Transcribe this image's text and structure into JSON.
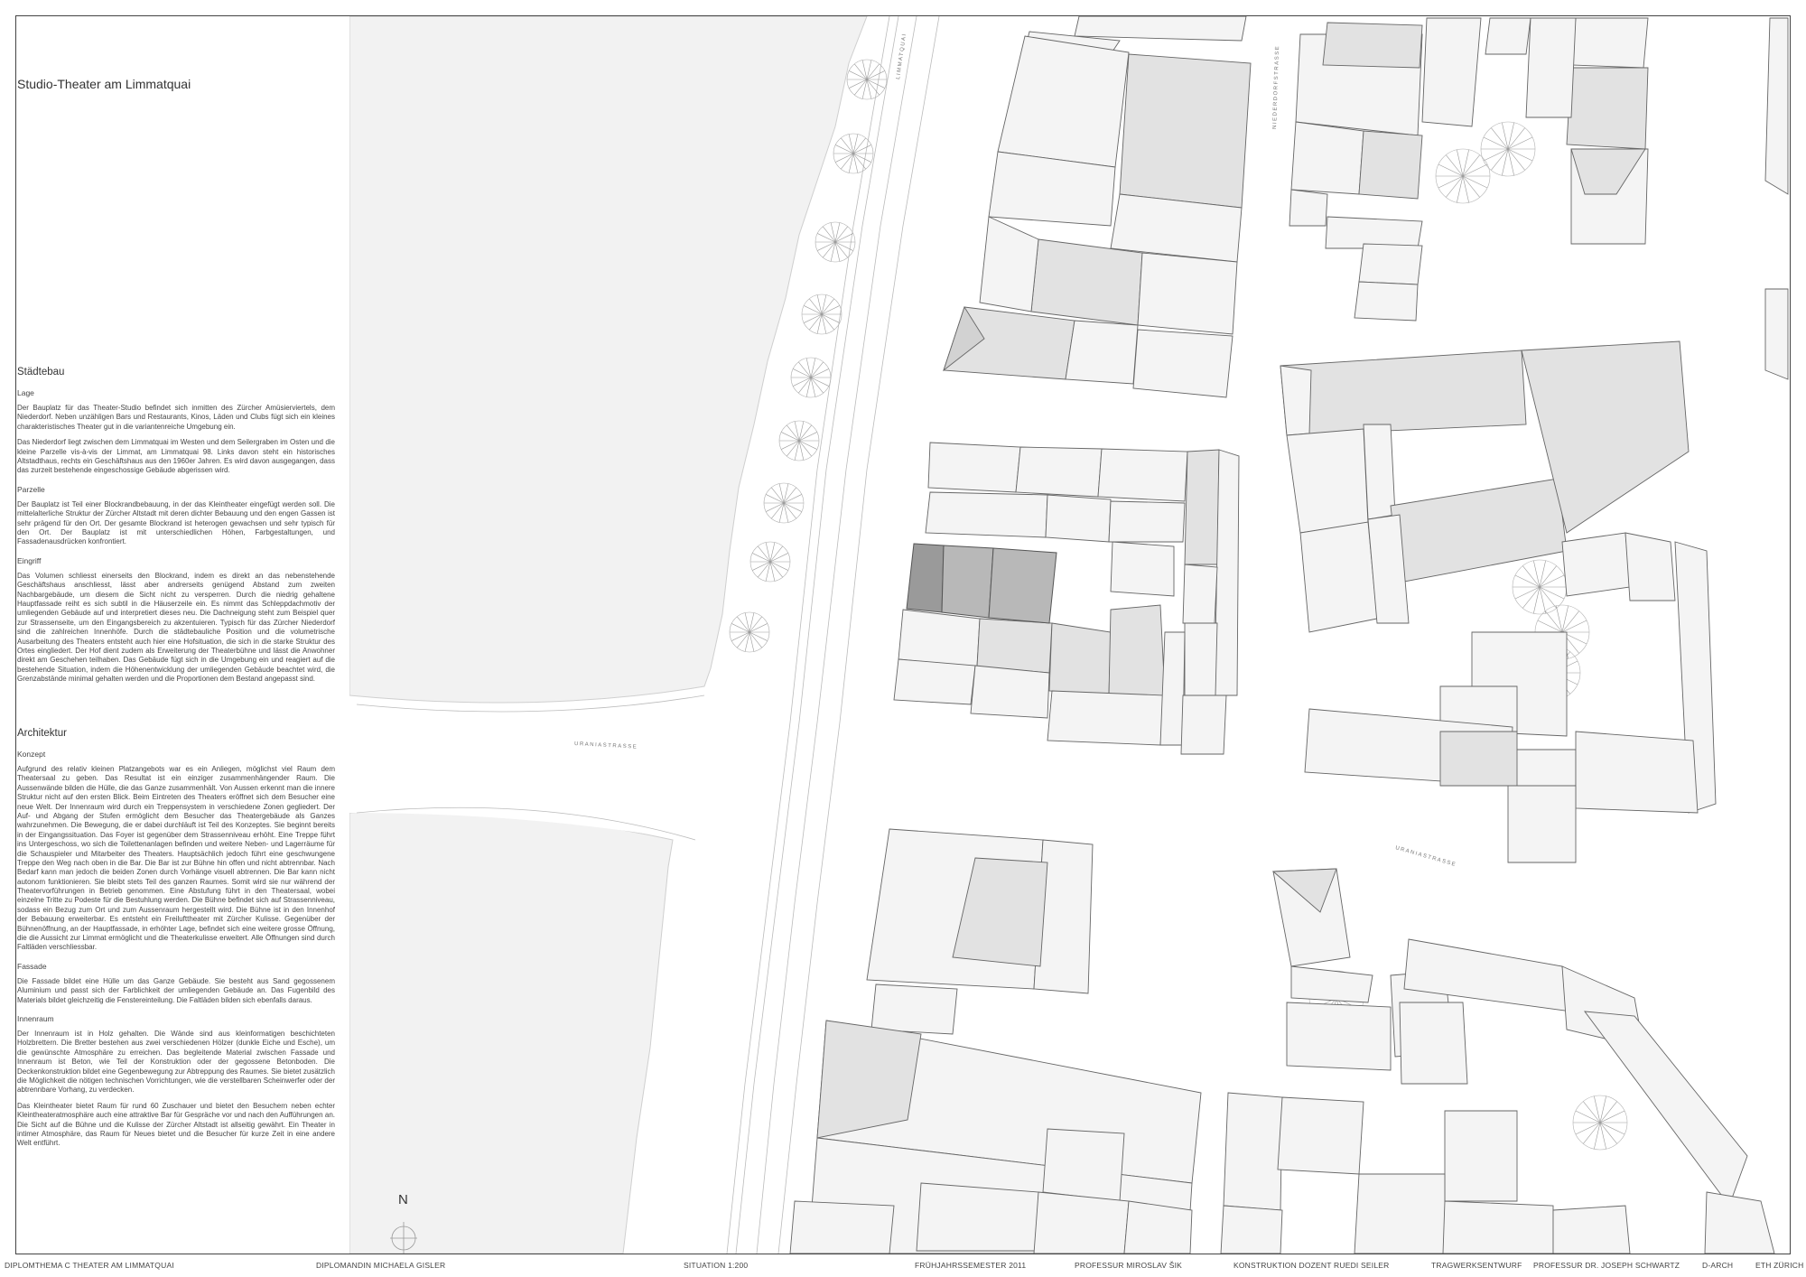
{
  "title": "Studio-Theater am Limmatquai",
  "sections": {
    "staedtebau": {
      "heading": "Städtebau",
      "lage": {
        "heading": "Lage",
        "paragraphs": [
          "Der Bauplatz für das Theater-Studio befindet sich inmitten des Zürcher Amüsierviertels, dem Niederdorf. Neben unzähligen Bars und Restaurants, Kinos, Läden und Clubs fügt sich ein kleines charakteristisches Theater gut in die variantenreiche Umgebung ein.",
          "Das Niederdorf liegt zwischen dem Limmatquai im Westen und dem Seilergraben im Osten und die kleine Parzelle vis-à-vis der Limmat, am Limmatquai 98. Links davon steht ein historisches Altstadthaus, rechts ein Geschäftshaus aus den 1960er Jahren. Es wird davon ausgegangen, dass das zurzeit bestehende eingeschossige Gebäude abgerissen wird."
        ]
      },
      "parzelle": {
        "heading": "Parzelle",
        "paragraphs": [
          "Der Bauplatz ist Teil einer Blockrandbebauung, in der das Kleintheater eingefügt werden soll. Die mittelalterliche Struktur der Zürcher Altstadt mit deren dichter Bebauung und den engen Gassen ist sehr prägend für den Ort. Der gesamte Blockrand ist heterogen gewachsen und sehr typisch für den Ort. Der Bauplatz ist mit unterschiedlichen Höhen, Farbgestaltungen, und Fassadenausdrücken konfrontiert."
        ]
      },
      "eingriff": {
        "heading": "Eingriff",
        "paragraphs": [
          "Das Volumen schliesst einerseits den Blockrand, indem es direkt an das nebenstehende Geschäftshaus anschliesst, lässt aber andrerseits genügend Abstand zum zweiten Nachbargebäude, um diesem die Sicht nicht zu versperren. Durch die niedrig gehaltene Hauptfassade reiht es sich subtil in die Häuserzeile ein. Es nimmt das Schleppdachmotiv der umliegenden Gebäude auf und interpretiert dieses neu. Die Dachneigung steht zum Beispiel quer zur Strassenseite, um den Eingangsbereich zu akzentuieren. Typisch für das Zürcher Niederdorf sind die zahlreichen Innenhöfe. Durch die städtebauliche Position und die volumetrische Ausarbeitung des Theaters entsteht auch hier eine Hofsituation, die sich in die starke Struktur des Ortes eingliedert. Der Hof dient zudem als Erweiterung der Theaterbühne und lässt die Anwohner direkt am Geschehen teilhaben. Das Gebäude fügt sich in die Umgebung ein und reagiert auf die bestehende Situation, indem die Höhenentwicklung der umliegenden Gebäude beachtet wird, die Grenzabstände minimal gehalten werden und die Proportionen dem Bestand angepasst sind."
        ]
      }
    },
    "architektur": {
      "heading": "Architektur",
      "konzept": {
        "heading": "Konzept",
        "paragraphs": [
          "Aufgrund des relativ kleinen Platzangebots war es ein Anliegen, möglichst viel Raum dem Theatersaal zu geben. Das Resultat ist ein einziger zusammenhängender Raum. Die Aussenwände bilden die Hülle, die das Ganze zusammenhält. Von Aussen erkennt man die innere Struktur nicht auf den ersten Blick. Beim Eintreten des Theaters eröffnet sich dem Besucher eine neue Welt. Der Innenraum wird durch ein Treppensystem in verschiedene Zonen gegliedert. Der Auf- und Abgang der Stufen ermöglicht dem Besucher das Theatergebäude als Ganzes wahrzunehmen. Die Bewegung, die er dabei durchläuft ist Teil des Konzeptes. Sie beginnt bereits in der Eingangssituation. Das Foyer ist gegenüber dem Strassenniveau erhöht. Eine Treppe führt ins Untergeschoss, wo sich die Toilettenanlagen befinden und weitere Neben- und Lagerräume für die Schauspieler und Mitarbeiter des Theaters. Hauptsächlich jedoch führt eine geschwungene Treppe den Weg nach oben in die Bar. Die Bar ist zur Bühne hin offen und nicht abtrennbar. Nach Bedarf kann man jedoch die beiden Zonen durch Vorhänge visuell abtrennen. Die Bar kann nicht autonom funktionieren. Sie bleibt stets Teil des ganzen Raumes. Somit wird sie nur während der Theatervorführungen in Betrieb genommen. Eine Abstufung führt in den Theatersaal, wobei einzelne Tritte zu Podeste für die Bestuhlung werden. Die Bühne befindet sich auf Strassenniveau, sodass ein Bezug zum Ort und zum Aussenraum hergestellt wird. Die Bühne ist in den Innenhof der Bebauung erweiterbar. Es entsteht ein Freilufttheater mit Zürcher Kulisse. Gegenüber der Bühnenöffnung, an der Hauptfassade, in erhöhter Lage, befindet sich eine weitere grosse Öffnung, die die Aussicht zur Limmat ermöglicht und die Theaterkulisse erweitert. Alle Öffnungen sind durch Faltläden verschliessbar."
        ]
      },
      "fassade": {
        "heading": "Fassade",
        "paragraphs": [
          "Die Fassade bildet eine Hülle um das Ganze Gebäude. Sie besteht aus Sand gegossenem Aluminium und passt sich der Farblichkeit der umliegenden Gebäude an. Das Fugenbild des Materials bildet gleichzeitig die Fenstereinteilung. Die Faltläden bilden sich ebenfalls daraus."
        ]
      },
      "innenraum": {
        "heading": "Innenraum",
        "paragraphs": [
          "Der Innenraum ist in Holz gehalten. Die Wände sind aus kleinformatigen beschichteten Holzbrettern. Die Bretter bestehen aus zwei verschiedenen Hölzer (dunkle Eiche und Esche), um die gewünschte Atmosphäre zu erreichen. Das begleitende Material zwischen Fassade und Innenraum ist Beton, wie Teil der Konstruktion oder der gegossene Betonboden. Die Deckenkonstruktion bildet eine Gegenbewegung zur Abtreppung des Raumes. Sie bietet zusätzlich die Möglichkeit die nötigen technischen Vorrichtungen, wie die verstellbaren Scheinwerfer oder der abtrennbare Vorhang, zu verdecken.",
          "Das Kleintheater bietet Raum für rund 60 Zuschauer und bietet den Besuchern neben echter Kleintheateratmosphäre auch eine attraktive Bar für Gespräche vor und nach den Aufführungen an. Die Sicht auf die Bühne und die Kulisse der Zürcher Altstadt ist allseitig gewährt. Ein Theater in intimer Atmosphäre, das Raum für Neues bietet und die Besucher für kurze Zeit in eine andere Welt entführt."
        ]
      }
    }
  },
  "map": {
    "streets": {
      "limmatquai": "LIMMATQUAI",
      "niederdorf": "NIEDERDORFSTRASSE",
      "urania1": "URANIASTRASSE",
      "urania2": "URANIASTRASSE"
    },
    "north": "N",
    "colors": {
      "river": "#f2f2f2",
      "building": "#f4f4f4",
      "building_mid": "#e2e2e2",
      "building_dark": "#d2d2d2",
      "site_dark": "#9a9a9a",
      "site_mid": "#b8b8b8",
      "line": "#666666"
    }
  },
  "footer": {
    "diplom": "DIPLOMTHEMA  C   THEATER  AM LIMMATQUAI",
    "diplomandin": "DIPLOMANDIN   MICHAELA GISLER",
    "situation": "SITUATION  1:200",
    "semester": "FRÜHJAHRSSEMESTER 2011",
    "professor": "PROFESSUR MIROSLAV ŠIK",
    "konstruktion": "KONSTRUKTION    DOZENT    RUEDI SEILER",
    "tragwerk": "TRAGWERKSENTWURF",
    "prof_schwartz": "PROFESSUR DR. JOSEPH SCHWARTZ",
    "darch": "D-ARCH",
    "eth": "ETH   ZÜRICH"
  }
}
